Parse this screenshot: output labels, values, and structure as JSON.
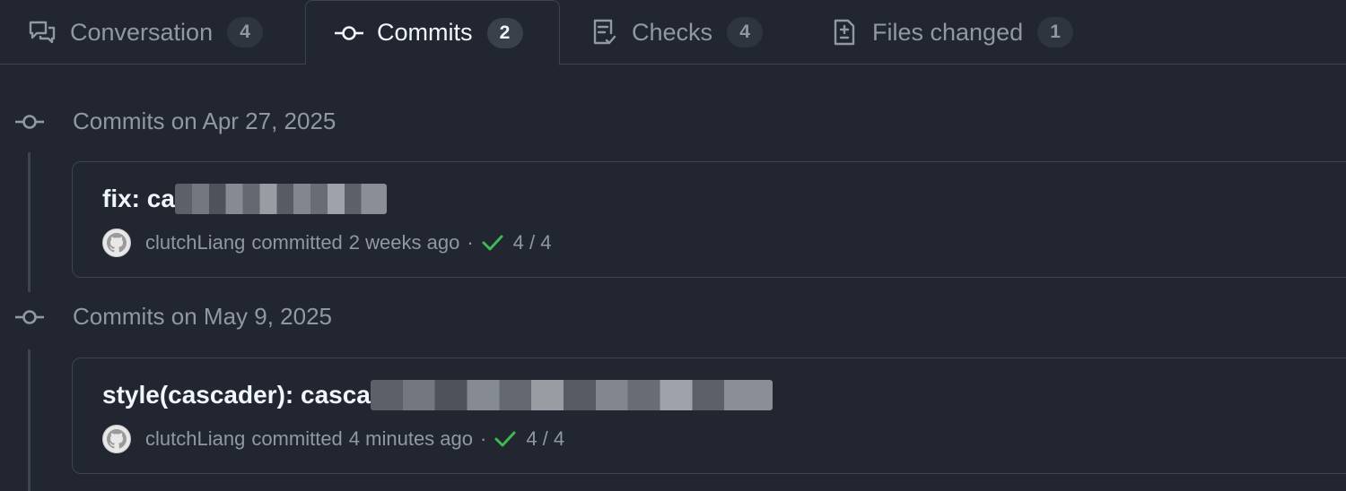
{
  "tabs": [
    {
      "label": "Conversation",
      "count": "4",
      "icon": "comment-discussion-icon"
    },
    {
      "label": "Commits",
      "count": "2",
      "icon": "git-commit-icon"
    },
    {
      "label": "Checks",
      "count": "4",
      "icon": "checklist-icon"
    },
    {
      "label": "Files changed",
      "count": "1",
      "icon": "file-diff-icon"
    }
  ],
  "active_tab": "Commits",
  "groups": [
    {
      "title": "Commits on Apr 27, 2025",
      "commit": {
        "title_prefix": "fix: ca",
        "author": "clutchLiang",
        "action": "committed",
        "time": "2 weeks ago",
        "separator": "·",
        "checks": "4 / 4",
        "check_status": "success"
      }
    },
    {
      "title": "Commits on May 9, 2025",
      "commit": {
        "title_prefix": "style(cascader): casca",
        "author": "clutchLiang",
        "action": "committed",
        "time": "4 minutes ago",
        "separator": "·",
        "checks": "4 / 4",
        "check_status": "success"
      }
    }
  ],
  "colors": {
    "background": "#212630",
    "border": "#3d444d",
    "muted_text": "#9198a1",
    "primary_text": "#f0f6fc",
    "success": "#3fb950"
  }
}
